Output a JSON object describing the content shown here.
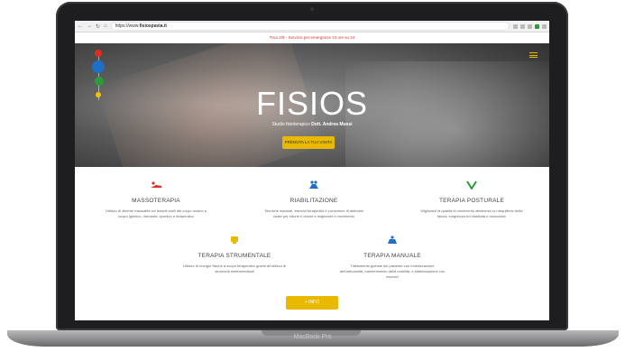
{
  "device": {
    "label": "MacBook Pro"
  },
  "browser": {
    "url_prefix": "https://www.",
    "url_domain": "fisiospavia.it",
    "back_glyph": "←",
    "forward_glyph": "→",
    "reload_glyph": "↻",
    "home_glyph": "⌂"
  },
  "notice": {
    "text": "Tisio 2/6 - Servizio per emergenze 24 ore su 24"
  },
  "hero": {
    "logo": "FISIOS",
    "subtitle_prefix": "Studio fisioterapico",
    "subtitle_names": "Dott. Andrea Mussi",
    "cta": "PRENOTA LA TUA VISITA",
    "dot_colors": [
      "#e02b20",
      "#1e6fc7",
      "#2a9d3a",
      "#f2c200"
    ]
  },
  "services": [
    {
      "title": "MASSOTERAPIA",
      "icon": "massage-icon",
      "color": "#d9342b",
      "desc": "Utilizzo di diverse manualità sui tessuti molli del corpo umano a scopo igienico, drenante, sportivo e terapeutico"
    },
    {
      "title": "RIABILITAZIONE",
      "icon": "rehab-icon",
      "color": "#1e6fc7",
      "desc": "Tecniche manuali, esercizi terapeutici e correzione di abitudini usate per ridurre il dolore e migliorare il movimento"
    },
    {
      "title": "TERAPIA POSTURALE",
      "icon": "posture-icon",
      "color": "#2a9d3a",
      "desc": "Migliorare la qualità di movimento attraverso un riequilibrio della fascia, lunghezza ed elasticità e muscolare"
    },
    {
      "title": "TERAPIA STRUMENTALE",
      "icon": "device-icon",
      "color": "#e8b900",
      "desc": "Utilizzo di energie fisiche a scopo terapeutico grazie all'utilizzo di strumenti elettromedicali"
    },
    {
      "title": "TERAPIA MANUALE",
      "icon": "manual-therapy-icon",
      "color": "#1e6fc7",
      "desc": "Trattamento globale del paziente con mobilizzazione dell'articolarità, mantenimento della mobilità, e stabilizzazione con esercizi"
    }
  ],
  "more_button": "+ INFO",
  "colors": {
    "accent": "#e8b900",
    "notice": "#d9342b"
  }
}
